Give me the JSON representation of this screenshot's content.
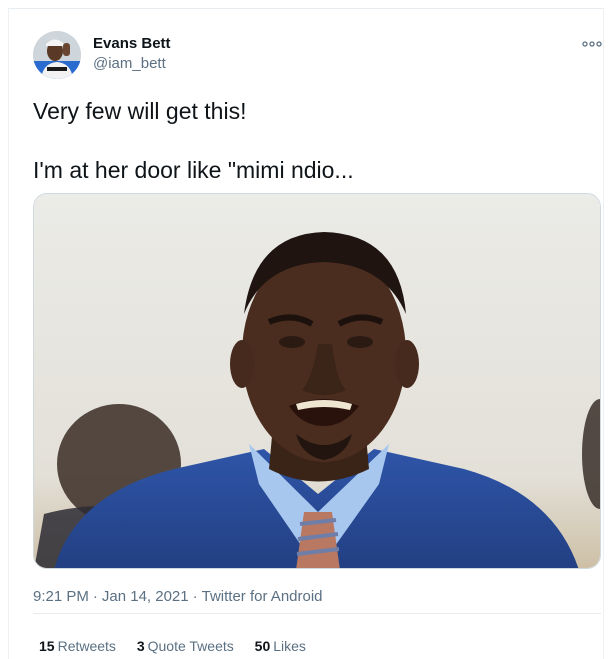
{
  "author": {
    "name": "Evans Bett",
    "handle": "@iam_bett"
  },
  "menu_icon": "more-options-icon",
  "tweet": {
    "line1": "Very few will get this!",
    "line2": "I'm at her door like \"mimi ndio..."
  },
  "meta": {
    "time": "9:21 PM",
    "separator": "·",
    "date": "Jan 14, 2021",
    "source": "Twitter for Android"
  },
  "stats": {
    "retweets": {
      "count": "15",
      "label": "Retweets"
    },
    "quotes": {
      "count": "3",
      "label": "Quote Tweets"
    },
    "likes": {
      "count": "50",
      "label": "Likes"
    }
  },
  "colors": {
    "text": "#0f1419",
    "secondary": "#5b7083",
    "border": "#e6ecf0"
  }
}
